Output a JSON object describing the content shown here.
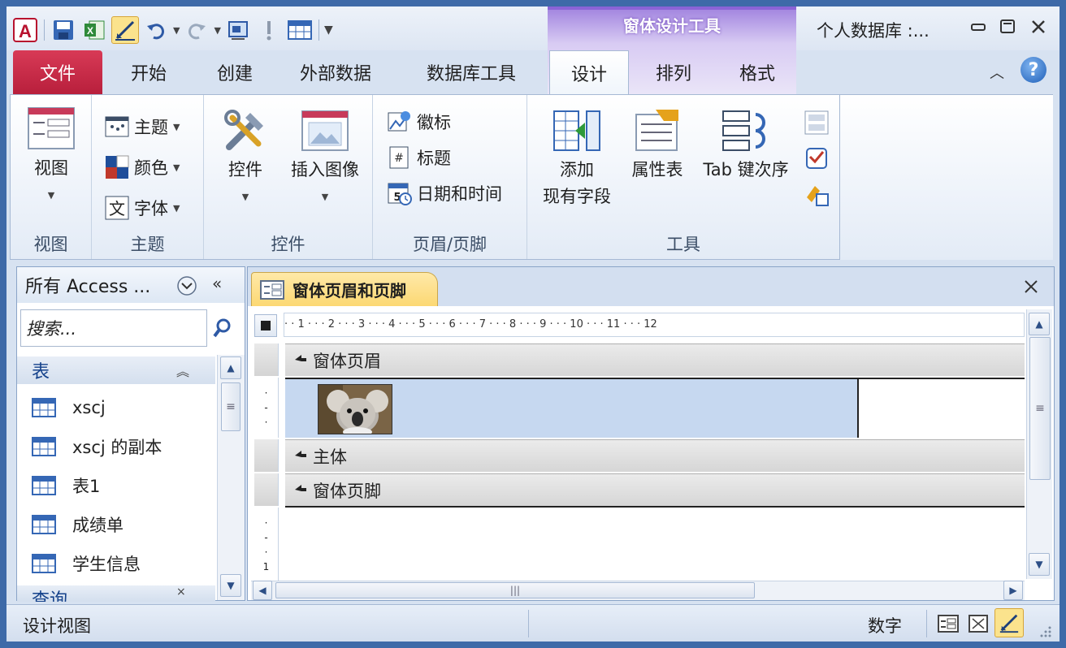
{
  "window": {
    "title": "个人数据库 :..."
  },
  "contextual": {
    "title": "窗体设计工具"
  },
  "tabs": {
    "file": "文件",
    "home": "开始",
    "create": "创建",
    "external": "外部数据",
    "dbtools": "数据库工具",
    "design": "设计",
    "arrange": "排列",
    "format": "格式"
  },
  "ribbon": {
    "views": {
      "view": "视图",
      "group": "视图"
    },
    "themes": {
      "theme": "主题",
      "colors": "颜色",
      "fonts": "字体",
      "group": "主题"
    },
    "controls": {
      "controls": "控件",
      "insert_image": "插入图像",
      "group": "控件"
    },
    "header_footer": {
      "logo": "徽标",
      "title": "标题",
      "datetime": "日期和时间",
      "group": "页眉/页脚"
    },
    "tools": {
      "add_fields_line1": "添加",
      "add_fields_line2": "现有字段",
      "property_sheet": "属性表",
      "tab_order": "Tab 键次序",
      "group": "工具"
    }
  },
  "nav": {
    "header": "所有 Access ...",
    "search_placeholder": "搜索...",
    "category_tables": "表",
    "category_queries": "查询",
    "items": [
      "xscj",
      "xscj 的副本",
      "表1",
      "成绩单",
      "学生信息"
    ]
  },
  "doc": {
    "tab": "窗体页眉和页脚",
    "ruler": "· · 1 · · · 2 · · · 3 · · · 4 · · · 5 · · · 6 · · · 7 · · · 8 · · · 9 · · · 10 · · · 11 · · · 12",
    "sections": {
      "header": "窗体页眉",
      "body": "主体",
      "footer": "窗体页脚"
    }
  },
  "status": {
    "view": "设计视图",
    "numlock": "数字"
  },
  "colors": {
    "accent": "#3e6aa8",
    "file_tab": "#c8284a",
    "contextual": "#a487e0",
    "header_section": "#c6d8f0"
  }
}
